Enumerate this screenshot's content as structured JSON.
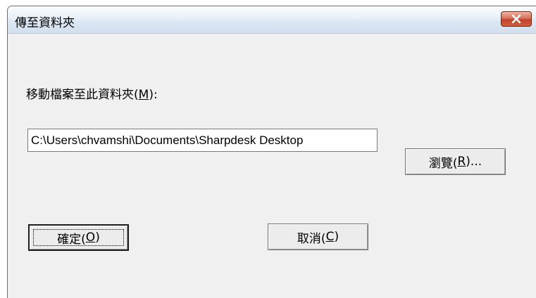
{
  "window": {
    "title": "傳至資料夾",
    "close_icon": "close-icon"
  },
  "content": {
    "label_text": "移動檔案至此資料夾(",
    "label_mnemonic": "M",
    "label_suffix": "):",
    "path_value": "C:\\Users\\chvamshi\\Documents\\Sharpdesk Desktop"
  },
  "buttons": {
    "browse": {
      "text": "瀏覽(",
      "mnemonic": "R",
      "suffix": ")..."
    },
    "ok": {
      "text": "確定(",
      "mnemonic": "O",
      "suffix": ")"
    },
    "cancel": {
      "text": "取消(",
      "mnemonic": "C",
      "suffix": ")"
    }
  },
  "colors": {
    "close_button": "#c8452b",
    "dialog_bg": "#f0f0f0"
  }
}
